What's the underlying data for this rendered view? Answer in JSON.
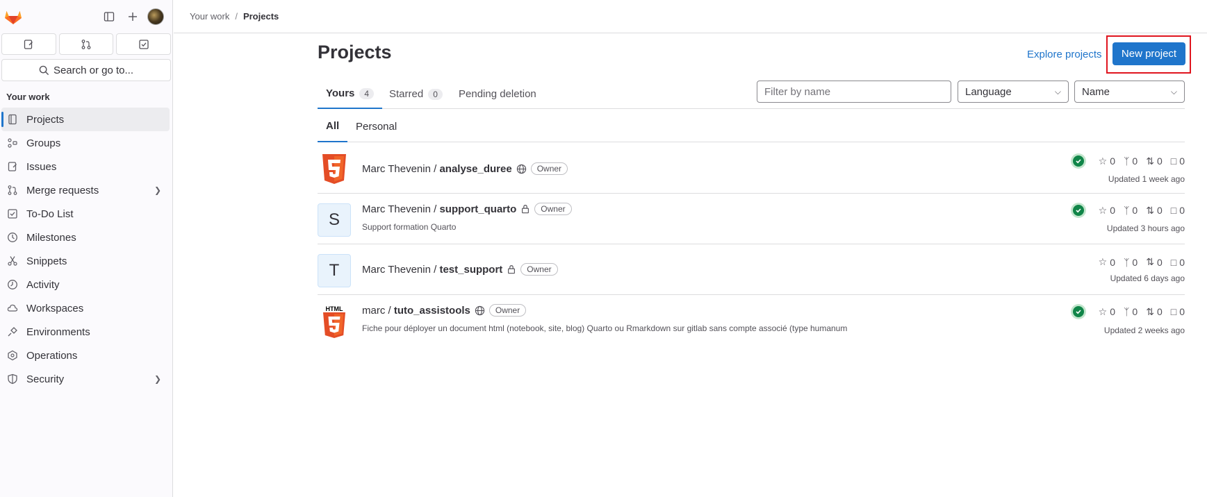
{
  "sidebar": {
    "search_label": "Search or go to...",
    "section_title": "Your work",
    "items": [
      {
        "label": "Projects",
        "icon": "project-icon"
      },
      {
        "label": "Groups",
        "icon": "group-icon"
      },
      {
        "label": "Issues",
        "icon": "issues-icon"
      },
      {
        "label": "Merge requests",
        "icon": "merge-request-icon"
      },
      {
        "label": "To-Do List",
        "icon": "todo-icon"
      },
      {
        "label": "Milestones",
        "icon": "milestone-icon"
      },
      {
        "label": "Snippets",
        "icon": "snippet-icon"
      },
      {
        "label": "Activity",
        "icon": "activity-icon"
      },
      {
        "label": "Workspaces",
        "icon": "workspace-icon"
      },
      {
        "label": "Environments",
        "icon": "environment-icon"
      },
      {
        "label": "Operations",
        "icon": "operations-icon"
      },
      {
        "label": "Security",
        "icon": "shield-icon"
      }
    ]
  },
  "breadcrumb": {
    "parent": "Your work",
    "separator": "/",
    "current": "Projects"
  },
  "header": {
    "title": "Projects",
    "explore_label": "Explore projects",
    "new_label": "New project"
  },
  "tabs": [
    {
      "label": "Yours",
      "count": "4"
    },
    {
      "label": "Starred",
      "count": "0"
    },
    {
      "label": "Pending deletion"
    }
  ],
  "filters": {
    "search_placeholder": "Filter by name",
    "language": "Language",
    "sort": "Name"
  },
  "subtabs": [
    "All",
    "Personal"
  ],
  "projects": [
    {
      "namespace": "Marc Thevenin / ",
      "name": "analyse_duree",
      "role": "Owner",
      "description": "",
      "stars": "0",
      "forks": "0",
      "mrs": "0",
      "issues": "0",
      "updated": "Updated 1 week ago"
    },
    {
      "namespace": "Marc Thevenin / ",
      "name": "support_quarto",
      "role": "Owner",
      "description": "Support formation Quarto",
      "avatar_letter": "S",
      "stars": "0",
      "forks": "0",
      "mrs": "0",
      "issues": "0",
      "updated": "Updated 3 hours ago"
    },
    {
      "namespace": "Marc Thevenin / ",
      "name": "test_support",
      "role": "Owner",
      "description": "",
      "avatar_letter": "T",
      "stars": "0",
      "forks": "0",
      "mrs": "0",
      "issues": "0",
      "updated": "Updated 6 days ago"
    },
    {
      "namespace": "marc / ",
      "name": "tuto_assistools",
      "role": "Owner",
      "description": "Fiche pour déployer un document html (notebook, site, blog) Quarto ou Rmarkdown sur gitlab sans compte associé (type humanum",
      "avatar_text": "HTML",
      "stars": "0",
      "forks": "0",
      "mrs": "0",
      "issues": "0",
      "updated": "Updated 2 weeks ago"
    }
  ],
  "colors": {
    "accent": "#1f75cb",
    "html5": "#e44d26",
    "success": "#108548",
    "highlight": "#e0141e"
  }
}
